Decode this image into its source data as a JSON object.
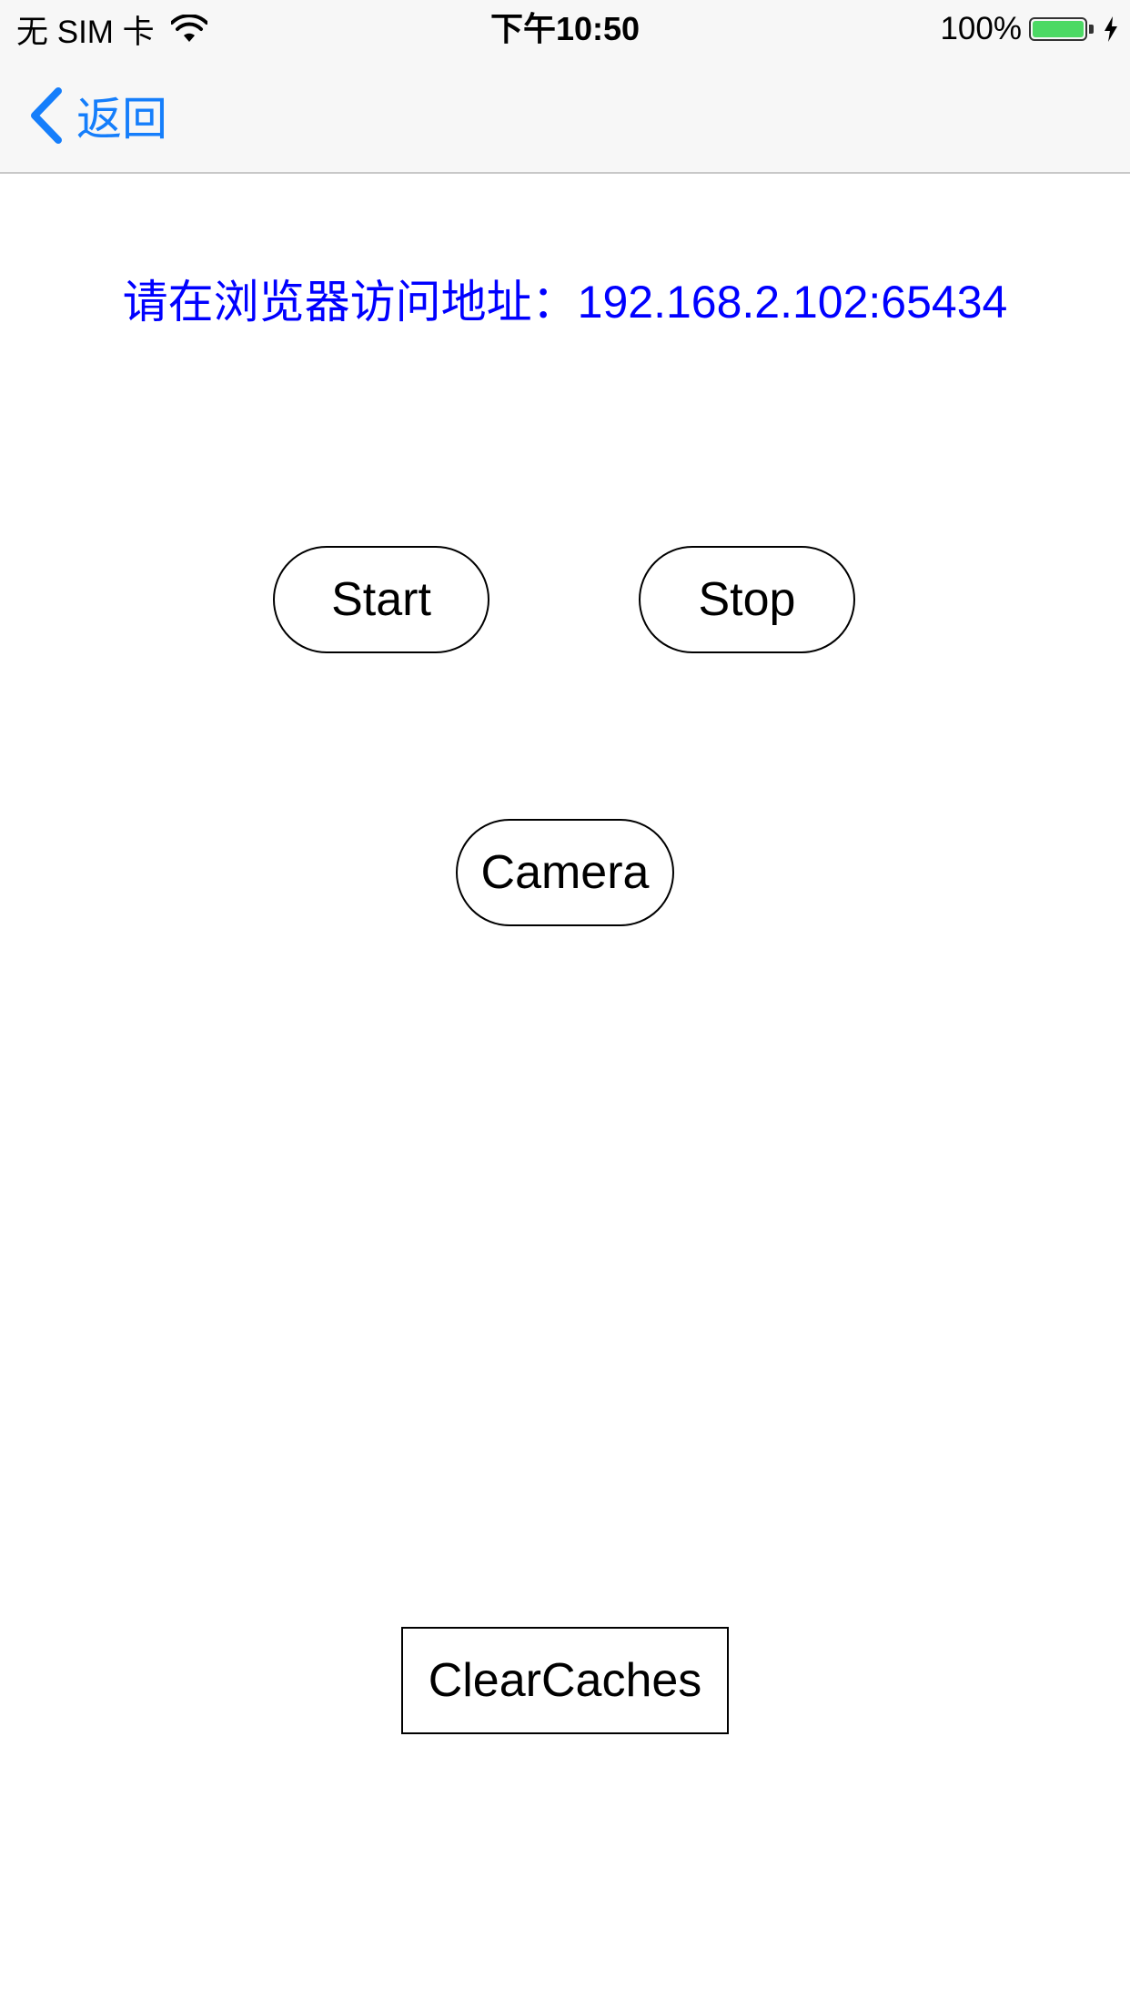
{
  "status_bar": {
    "carrier": "无 SIM 卡",
    "time": "下午10:50",
    "battery_percent": "100%",
    "battery_level": 1.0,
    "battery_color": "#4cd964",
    "icons": [
      "wifi-icon",
      "battery-icon",
      "charging-bolt-icon"
    ]
  },
  "nav": {
    "back_label": "返回",
    "back_icon": "chevron-left-icon",
    "tint_color": "#157efb"
  },
  "main": {
    "address_text": "请在浏览器访问地址：192.168.2.102:65434",
    "address_color": "#0000ff",
    "start_label": "Start",
    "stop_label": "Stop",
    "camera_label": "Camera",
    "clear_caches_label": "ClearCaches"
  }
}
